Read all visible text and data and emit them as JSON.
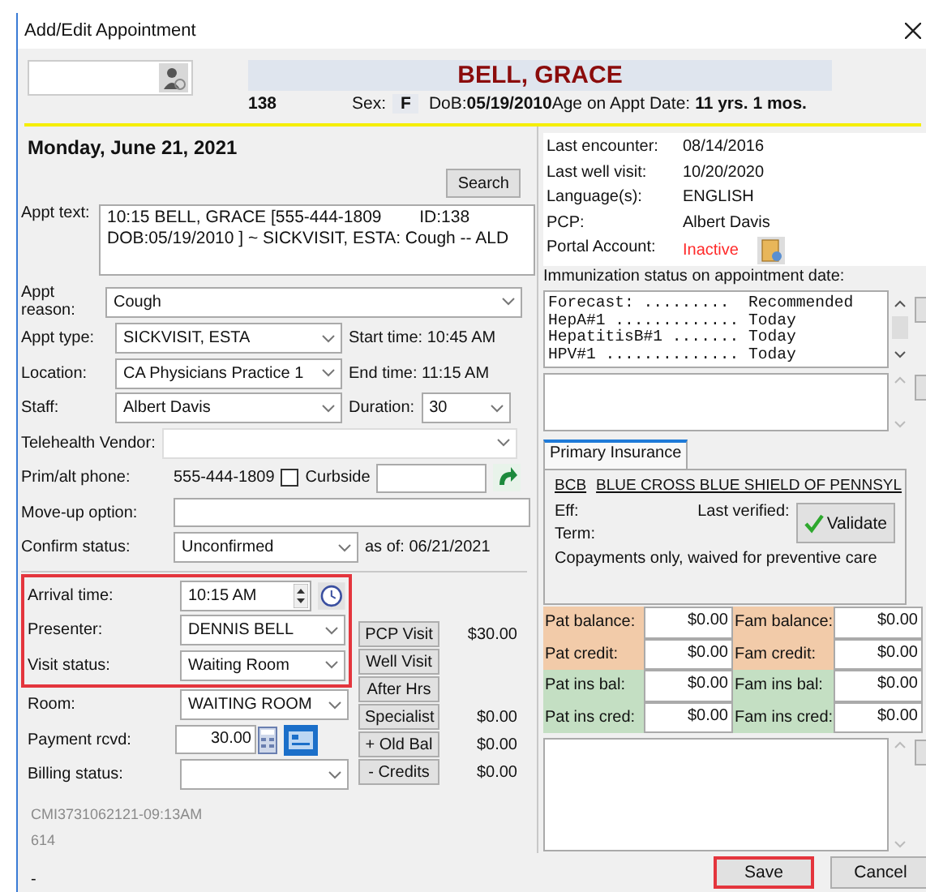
{
  "window": {
    "title": "Add/Edit Appointment"
  },
  "patient": {
    "name": "BELL, GRACE",
    "id": "138",
    "sex_label": "Sex:",
    "sex": "F",
    "dob_label": "DoB:",
    "dob": "05/19/2010",
    "age_label": "Age on Appt Date:",
    "age": "11 yrs. 1 mos."
  },
  "date": "Monday, June 21, 2021",
  "search_button": "Search",
  "appt_text": {
    "label": "Appt text:",
    "value": "10:15 BELL, GRACE [555-444-1809        ID:138\nDOB:05/19/2010 ] ~ SICKVISIT, ESTA: Cough -- ALD"
  },
  "appt_reason": {
    "label": "Appt reason:",
    "value": "Cough"
  },
  "appt_type": {
    "label": "Appt type:",
    "value": "SICKVISIT, ESTA"
  },
  "start_time": {
    "label": "Start time:",
    "value": "10:45 AM"
  },
  "location": {
    "label": "Location:",
    "value": "CA Physicians Practice 1"
  },
  "end_time": {
    "label": "End time:",
    "value": "11:15 AM"
  },
  "staff": {
    "label": "Staff:",
    "value": "Albert Davis"
  },
  "duration": {
    "label": "Duration:",
    "value": "30"
  },
  "telehealth_vendor": {
    "label": "Telehealth Vendor:",
    "disabled": true
  },
  "phone": {
    "label": "Prim/alt phone:",
    "value": "555-444-1809"
  },
  "curbside": {
    "label": "Curbside",
    "checked": false
  },
  "move_up": {
    "label": "Move-up option:"
  },
  "confirm_status": {
    "label": "Confirm status:",
    "value": "Unconfirmed",
    "as_of_label": "as of:",
    "as_of": "06/21/2021"
  },
  "arrival_group": {
    "highlighted": true,
    "arrival_time": {
      "label": "Arrival time:",
      "value": "10:15 AM"
    },
    "presenter": {
      "label": "Presenter:",
      "value": "DENNIS BELL"
    },
    "visit_status": {
      "label": "Visit status:",
      "value": "Waiting Room"
    }
  },
  "room": {
    "label": "Room:",
    "value": "WAITING ROOM"
  },
  "payment": {
    "label": "Payment rcvd:",
    "value": "30.00"
  },
  "billing_status": {
    "label": "Billing status:"
  },
  "copay_buttons": [
    {
      "label": "PCP Visit",
      "amount": "$30.00"
    },
    {
      "label": "Well Visit"
    },
    {
      "label": "After Hrs"
    },
    {
      "label": "Specialist",
      "amount": "$0.00"
    },
    {
      "label": "+ Old Bal",
      "amount": "$0.00"
    },
    {
      "label": "- Credits",
      "amount": "$0.00"
    }
  ],
  "footer_info": [
    "CMI3731062121-09:13AM",
    "614"
  ],
  "status_mark": "-",
  "patient_info": [
    {
      "label": "Last encounter:",
      "value": "08/14/2016",
      "alert": false
    },
    {
      "label": "Last well visit:",
      "value": "10/20/2020",
      "alert": false
    },
    {
      "label": "Language(s):",
      "value": "ENGLISH",
      "alert": false
    },
    {
      "label": "PCP:",
      "value": "Albert Davis",
      "alert": false
    },
    {
      "label": "Portal Account:",
      "value": "Inactive",
      "alert": true
    }
  ],
  "immunization": {
    "label": "Immunization status on appointment date:",
    "lines": [
      "Forecast: .........  Recommended",
      "HepA#1 ............. Today",
      "HepatitisB#1 ....... Today",
      "HPV#1 .............. Today"
    ]
  },
  "insurance": {
    "tabs": [
      {
        "label": "Primary Insurance",
        "selected": true
      }
    ],
    "code": "BCB",
    "plan": "BLUE CROSS BLUE SHIELD OF PENNSYL",
    "eff_label": "Eff:",
    "term_label": "Term:",
    "last_verified_label": "Last verified:",
    "validate_button": "Validate",
    "note": "Copayments only, waived for preventive care"
  },
  "balances": [
    {
      "label": "Pat balance:",
      "value": "$0.00",
      "kind": "account"
    },
    {
      "label": "Fam balance:",
      "value": "$0.00",
      "kind": "account"
    },
    {
      "label": "Pat credit:",
      "value": "$0.00",
      "kind": "account"
    },
    {
      "label": "Fam credit:",
      "value": "$0.00",
      "kind": "account"
    },
    {
      "label": "Pat ins bal:",
      "value": "$0.00",
      "kind": "insurance"
    },
    {
      "label": "Fam ins bal:",
      "value": "$0.00",
      "kind": "insurance"
    },
    {
      "label": "Pat ins cred:",
      "value": "$0.00",
      "kind": "insurance"
    },
    {
      "label": "Fam ins cred:",
      "value": "$0.00",
      "kind": "insurance"
    }
  ],
  "buttons": [
    {
      "label": "Save",
      "highlighted": true
    },
    {
      "label": "Cancel",
      "highlighted": false
    }
  ]
}
